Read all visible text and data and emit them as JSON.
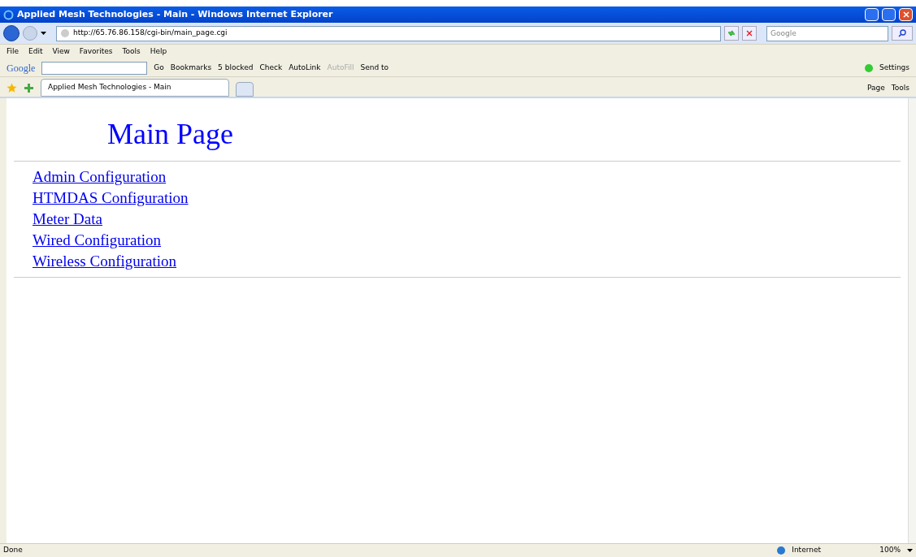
{
  "window": {
    "title": "Applied Mesh Technologies - Main - Windows Internet Explorer"
  },
  "address_bar": {
    "value": "http://65.76.86.158/cgi-bin/main_page.cgi"
  },
  "search": {
    "placeholder": "Google"
  },
  "menu": [
    "File",
    "Edit",
    "View",
    "Favorites",
    "Tools",
    "Help"
  ],
  "google_toolbar": {
    "logo": "Google",
    "go": "Go",
    "items": [
      {
        "label": "Bookmarks",
        "disabled": false
      },
      {
        "label": "5 blocked",
        "disabled": false
      },
      {
        "label": "Check",
        "disabled": false
      },
      {
        "label": "AutoLink",
        "disabled": false
      },
      {
        "label": "AutoFill",
        "disabled": true
      },
      {
        "label": "Send to",
        "disabled": false
      }
    ],
    "settings": "Settings"
  },
  "tabs": [
    {
      "label": "Applied Mesh Technologies - Main",
      "selected": true
    }
  ],
  "command_bar": [
    {
      "label": "Page"
    },
    {
      "label": "Tools"
    }
  ],
  "page": {
    "heading": "Main Page",
    "links": [
      "Admin Configuration",
      "HTMDAS Configuration",
      "Meter Data",
      "Wired Configuration",
      "Wireless Configuration"
    ]
  },
  "status_bar": {
    "status": "Done",
    "zone": "Internet",
    "zoom": "100%"
  }
}
